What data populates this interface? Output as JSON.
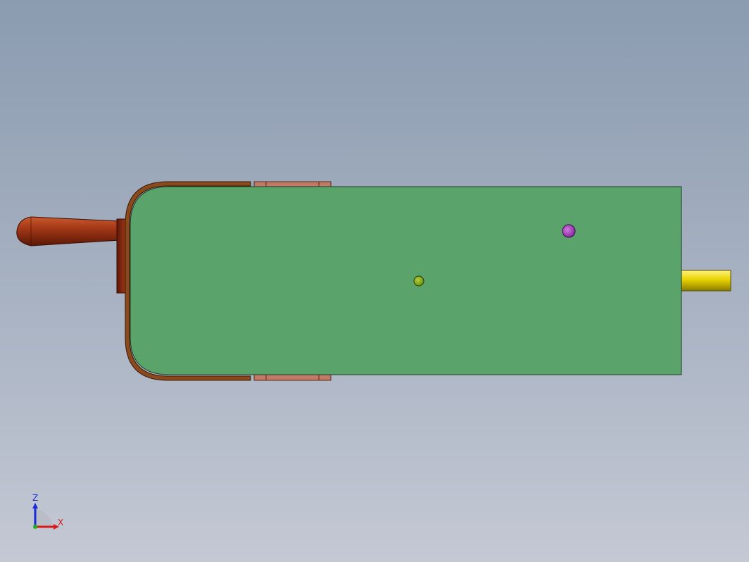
{
  "viewport": {
    "background_top": "#8b9bb0",
    "background_bottom": "#c4c9d4"
  },
  "model": {
    "body_color": "#5aa46b",
    "frame_color": "#8a4a1e",
    "handle_color": "#9b2d10",
    "shaft_color": "#e8d200",
    "marker_purple": "#a046b4",
    "marker_green": "#8cb414"
  },
  "triad": {
    "z_label": "Z",
    "x_label": "X",
    "z_color": "#1a2ad8",
    "x_color": "#d81a1a"
  }
}
